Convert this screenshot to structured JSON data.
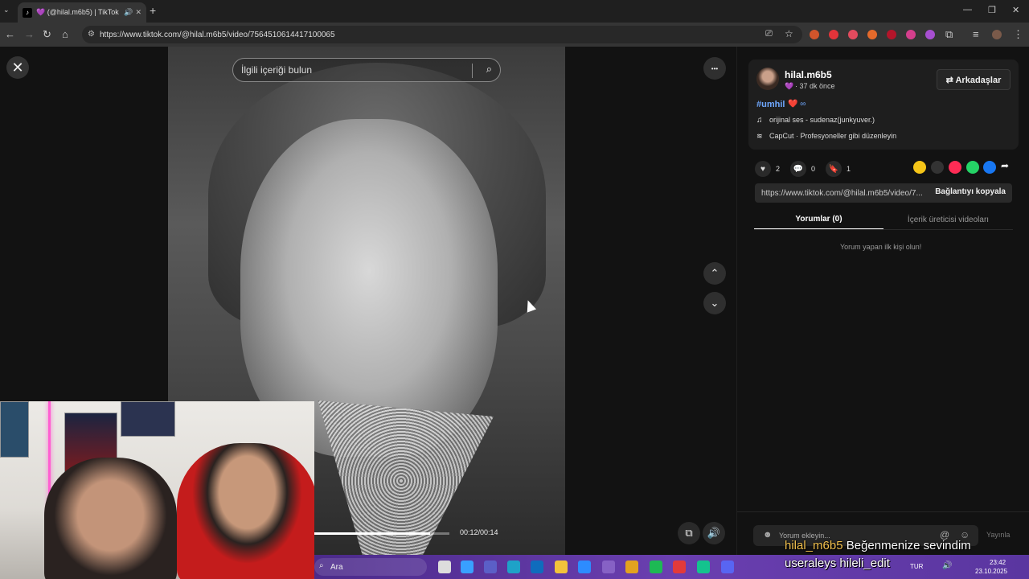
{
  "browser": {
    "tab_title": "💜 (@hilal.m6b5) | TikTok",
    "new_tab": "+",
    "url": "https://www.tiktok.com/@hilal.m6b5/video/7564510614417100065",
    "window_minimize": "—",
    "window_restore": "❐",
    "window_close": "✕"
  },
  "page": {
    "close_glyph": "✕",
    "search_placeholder": "İlgili içeriği bulun",
    "more_glyph": "•••",
    "nav_up": "⌃",
    "nav_down": "⌄",
    "video_time": "00:12/00:14",
    "progress": 0.86
  },
  "author": {
    "name": "hilal.m6b5",
    "time_ago": "· 37 dk önce",
    "heart_emoji": "💜",
    "friends_button": "⇄ Arkadaşlar",
    "hashtag": "#umhil",
    "hashtag_emoji": "❤️ ∞",
    "sound_label": "orijinal ses - sudenaz(junkyuver.)",
    "capcut_label": "CapCut · Profesyoneller gibi düzenleyin"
  },
  "actions": {
    "likes": "2",
    "comments": "0",
    "saves": "1"
  },
  "share": {
    "link": "https://www.tiktok.com/@hilal.m6b5/video/7...",
    "copy_button": "Bağlantıyı kopyala"
  },
  "tabs": {
    "comments": "Yorumlar (0)",
    "creator_videos": "İçerik üreticisi videoları"
  },
  "comments": {
    "empty_text": "Yorum yapan ilk kişi olun!",
    "input_placeholder": "Yorum ekleyin...",
    "post_button": "Yayınla"
  },
  "taskbar": {
    "search": "Ara",
    "language": "TUR",
    "time": "23:42",
    "date": "23.10.2025"
  },
  "stream_overlay": {
    "line1_name": "hilal_m6b5",
    "line1_msg": "Beğenmenize sevindim",
    "line2_name": "useraleys",
    "line2_msg": "hileli_edit"
  },
  "colors": {
    "accent_hashtag": "#6fa8ff",
    "taskbar": "#5a36a0"
  }
}
